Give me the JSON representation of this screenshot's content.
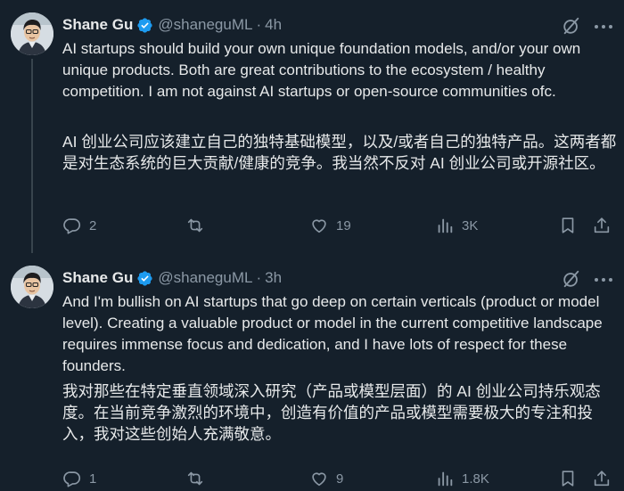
{
  "tweets": [
    {
      "author": {
        "name": "Shane Gu",
        "handle": "@shaneguML",
        "time": "4h"
      },
      "text_en": "AI startups should build your own unique foundation models, and/or your own unique products. Both are great contributions to the ecosystem / healthy competition. I am not against AI startups or open-source communities ofc.",
      "text_zh": "AI 创业公司应该建立自己的独特基础模型，以及/或者自己的独特产品。这两者都是对生态系统的巨大贡献/健康的竞争。我当然不反对 AI 创业公司或开源社区。",
      "stats": {
        "replies": "2",
        "reposts": "",
        "likes": "19",
        "views": "3K"
      }
    },
    {
      "author": {
        "name": "Shane Gu",
        "handle": "@shaneguML",
        "time": "3h"
      },
      "text_en": "And I'm bullish on AI startups that go deep on certain verticals (product or model level). Creating a valuable product or model in the current competitive landscape requires immense focus and dedication, and I have lots of respect for these founders.",
      "text_zh": "我对那些在特定垂直领域深入研究（产品或模型层面）的 AI 创业公司持乐观态度。在当前竞争激烈的环境中，创造有价值的产品或模型需要极大的专注和投入，我对这些创始人充满敬意。",
      "stats": {
        "replies": "1",
        "reposts": "",
        "likes": "9",
        "views": "1.8K"
      }
    }
  ],
  "separator": "·",
  "colors": {
    "background": "#15202b",
    "text": "#e7e9ea",
    "secondary": "#8b98a5",
    "verified": "#1d9bf0",
    "thread_line": "#38444d"
  },
  "icons": [
    "verified-badge-icon",
    "grok-icon",
    "more-icon",
    "reply-icon",
    "repost-icon",
    "like-icon",
    "views-icon",
    "bookmark-icon",
    "share-icon"
  ]
}
